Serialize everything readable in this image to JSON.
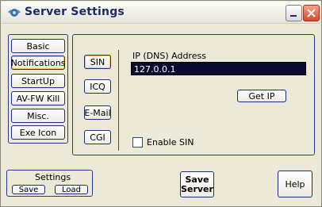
{
  "window": {
    "title": "Server Settings"
  },
  "titlebar_buttons": {
    "minimize": "minimize",
    "close": "close"
  },
  "nav": {
    "items": [
      {
        "label": "Basic"
      },
      {
        "label": "Notifications",
        "selected": true
      },
      {
        "label": "StartUp"
      },
      {
        "label": "AV-FW Kill"
      },
      {
        "label": "Misc."
      },
      {
        "label": "Exe Icon"
      }
    ]
  },
  "notify": {
    "methods": [
      {
        "label": "SIN",
        "selected": true
      },
      {
        "label": "ICQ"
      },
      {
        "label": "E-Mail"
      },
      {
        "label": "CGI"
      }
    ],
    "ip_label": "IP (DNS) Address",
    "ip_value": "127.0.0.1",
    "get_ip": "Get IP",
    "enable_label": "Enable SIN",
    "enable_checked": false
  },
  "settings": {
    "label": "Settings",
    "save": "Save",
    "load": "Load"
  },
  "save_server": {
    "line1": "Save",
    "line2": "Server"
  },
  "help": "Help",
  "colors": {
    "accent": "#1e2e78",
    "field_bg": "#0a0a2e",
    "close_red": "#d84a2a"
  }
}
